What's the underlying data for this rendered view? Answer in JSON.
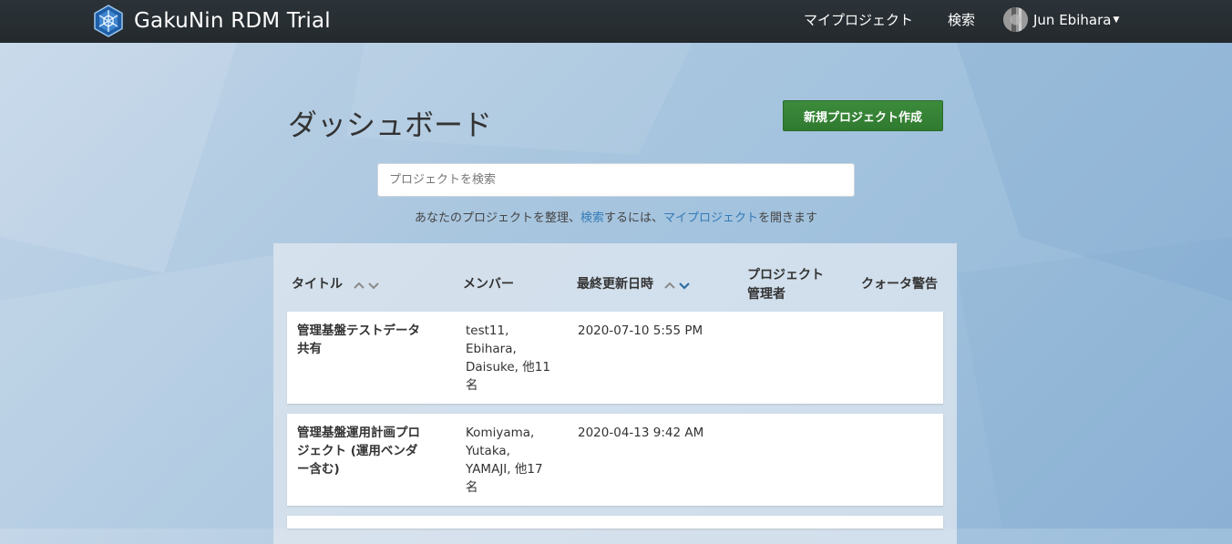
{
  "navbar": {
    "brand": "GakuNin RDM Trial",
    "my_projects": "マイプロジェクト",
    "search": "検索",
    "user_name": "Jun Ebihara"
  },
  "header": {
    "title": "ダッシュボード",
    "new_project_button": "新規プロジェクト作成"
  },
  "search": {
    "placeholder": "プロジェクトを検索"
  },
  "helper": {
    "prefix": "あなたのプロジェクトを整理、",
    "search_link": "検索",
    "middle": "するには、",
    "my_projects_link": "マイプロジェクト",
    "suffix": "を開きます"
  },
  "table": {
    "columns": {
      "title": "タイトル",
      "members": "メンバー",
      "updated": "最終更新日時",
      "admin_line1": "プロジェクト",
      "admin_line2": "管理者",
      "quota": "クォータ警告"
    },
    "sort_up": "⌃",
    "sort_down": "⌄",
    "rows": [
      {
        "title": "管理基盤テストデータ共有",
        "members": "test11, Ebihara, Daisuke, 他11名",
        "updated": "2020-07-10 5:55 PM"
      },
      {
        "title": "管理基盤運用計画プロジェクト (運用ベンダー含む)",
        "members": "Komiyama, Yutaka, YAMAJI, 他17名",
        "updated": "2020-04-13 9:42 AM"
      }
    ]
  },
  "colors": {
    "navbar": "#263238",
    "primary_button": "#2e7d32",
    "link": "#337ab7"
  }
}
